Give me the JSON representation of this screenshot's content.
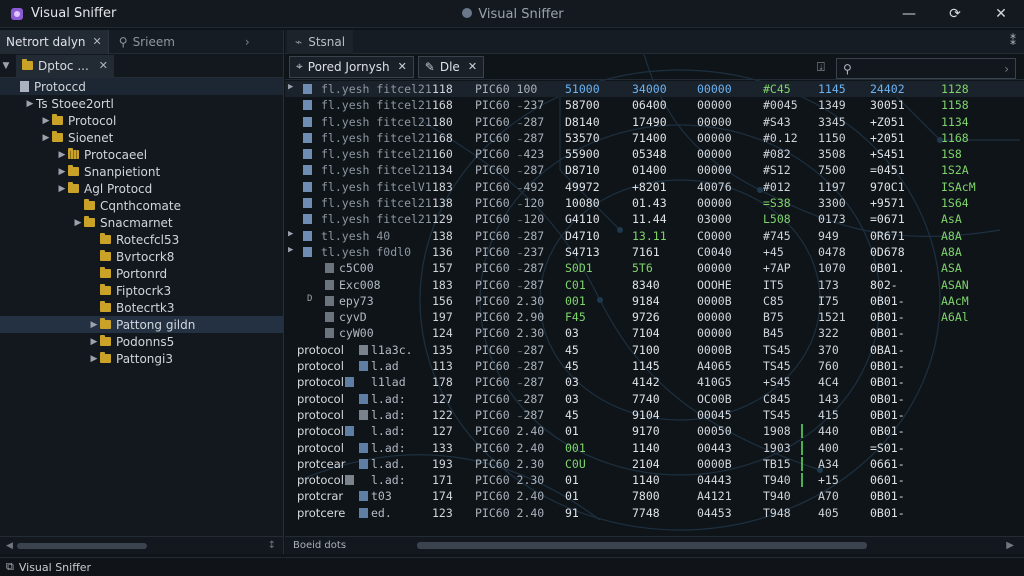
{
  "app": {
    "title": "Visual Sniffer",
    "center_title": "Visual Sniffer"
  },
  "colors": {
    "background": "#0f1419",
    "accent_blue": "#6db3f2",
    "accent_green": "#5cb85c",
    "folder": "#c9a227"
  },
  "left": {
    "tab_label": "Netrort dalyn",
    "search_label": "Srieem",
    "subtab_label": "Dptoc ...",
    "tree": [
      {
        "label": "Protoccd",
        "indent": 0,
        "exp": "",
        "icon": "file",
        "state": "selected-soft"
      },
      {
        "label": "Ts Stoee2ortl",
        "indent": 1,
        "exp": "▶",
        "icon": "none",
        "state": ""
      },
      {
        "label": "Protocol",
        "indent": 2,
        "exp": "▶",
        "icon": "folder",
        "state": ""
      },
      {
        "label": "Sioenet",
        "indent": 2,
        "exp": "▶",
        "icon": "folder",
        "state": ""
      },
      {
        "label": "Protocaeel",
        "indent": 3,
        "exp": "▶",
        "icon": "grid",
        "state": ""
      },
      {
        "label": "Snanpietiont",
        "indent": 3,
        "exp": "▶",
        "icon": "folder",
        "state": ""
      },
      {
        "label": "Agl Protocd",
        "indent": 3,
        "exp": "▶",
        "icon": "folder",
        "state": ""
      },
      {
        "label": "Cqnthcomate",
        "indent": 4,
        "exp": "",
        "icon": "folder",
        "state": ""
      },
      {
        "label": "Snacmarnet",
        "indent": 4,
        "exp": "▶",
        "icon": "folder",
        "state": ""
      },
      {
        "label": "Rotecfcl53",
        "indent": 5,
        "exp": "",
        "icon": "folder",
        "state": ""
      },
      {
        "label": "Bvrtocrk8",
        "indent": 5,
        "exp": "",
        "icon": "folder",
        "state": ""
      },
      {
        "label": "Portonrd",
        "indent": 5,
        "exp": "",
        "icon": "folder",
        "state": ""
      },
      {
        "label": "Fiptocrk3",
        "indent": 5,
        "exp": "",
        "icon": "folder",
        "state": ""
      },
      {
        "label": "Botecrtk3",
        "indent": 5,
        "exp": "",
        "icon": "folder",
        "state": ""
      },
      {
        "label": "Pattong gildn",
        "indent": 5,
        "exp": "▶",
        "icon": "folder",
        "state": "selected"
      },
      {
        "label": "Podonns5",
        "indent": 5,
        "exp": "▶",
        "icon": "folder",
        "state": ""
      },
      {
        "label": "Pattongi3",
        "indent": 5,
        "exp": "▶",
        "icon": "folder",
        "state": ""
      }
    ]
  },
  "right": {
    "tab_label": "Stsnal",
    "filter_tab_1": "Pored Jornysh",
    "filter_tab_2": "Dle",
    "bottom_text": "Boeid dots",
    "rows": [
      {
        "kind": "top",
        "mark": "▶",
        "name": "fl.yesh  fitcel21",
        "a": "118",
        "b": "PIC60 100",
        "c": "51000",
        "d": "34000",
        "e": "00000",
        "f": "#C45",
        "g": "1145",
        "h": "24402",
        "i": "1128",
        "cc": "blue",
        "dc": "blue",
        "ec": "blue",
        "fc": "green",
        "gc": "blue",
        "hc": "blue",
        "ic": "green"
      },
      {
        "kind": "top",
        "mark": "",
        "name": "fl.yesh  fitcel21",
        "a": "168",
        "b": "PIC60 ₋237",
        "c": "58700",
        "d": "06400",
        "e": "00000",
        "f": "#0045",
        "g": "1349",
        "h": "30051",
        "i": "1158",
        "ic": "green"
      },
      {
        "kind": "top",
        "mark": "",
        "name": "fl.yesh  fitcel21",
        "a": "180",
        "b": "PIC60 ₋287",
        "c": "D8140",
        "d": "17490",
        "e": "00000",
        "f": "#S43",
        "g": "3345",
        "h": "+Z051",
        "i": "1134",
        "ic": "green"
      },
      {
        "kind": "top",
        "mark": "",
        "name": "fl.yesh  fitcel21",
        "a": "168",
        "b": "PIC60 ₋287",
        "c": "53570",
        "d": "71400",
        "e": "00000",
        "f": "#0.12",
        "g": "1150",
        "h": "+2051",
        "i": "1168",
        "ic": "green"
      },
      {
        "kind": "top",
        "mark": "",
        "name": "fl.yesh  fitcel21",
        "a": "160",
        "b": "PIC60 ₋423",
        "c": "55900",
        "d": "05348",
        "e": "00000",
        "f": "#082",
        "g": "3508",
        "h": "+S451",
        "i": "1S8",
        "ic": "green"
      },
      {
        "kind": "top",
        "mark": "",
        "name": "fl.yesh  fitcel21",
        "a": "134",
        "b": "PIC60 ₋287",
        "c": "D8710",
        "d": "01400",
        "e": "00000",
        "f": "#S12",
        "g": "7500",
        "h": "=0451",
        "i": "1S2A",
        "ic": "green"
      },
      {
        "kind": "top",
        "mark": "",
        "name": "fl.yesh  fitcelV1",
        "a": "183",
        "b": "PIC60 ₋492",
        "c": "49972",
        "d": "+8201",
        "e": "40076",
        "f": "#012",
        "g": "1197",
        "h": "970C1",
        "i": "ISAcM",
        "ic": "green"
      },
      {
        "kind": "top",
        "mark": "",
        "name": "fl.yesh  fitcel21",
        "a": "138",
        "b": "PIC60 ₋120",
        "c": "10080",
        "d": "01.43",
        "e": "00000",
        "f": "=S38",
        "g": "3300",
        "h": "+9571",
        "i": "1S64",
        "fc": "green",
        "ic": "green"
      },
      {
        "kind": "top",
        "mark": "",
        "name": "fl.yesh  fitcel21",
        "a": "129",
        "b": "PIC60 ₋120",
        "c": "G4110",
        "d": "11.44",
        "e": "03000",
        "f": "L508",
        "g": "0173",
        "h": "=0671",
        "i": "AsA",
        "fc": "green",
        "ic": "green"
      },
      {
        "kind": "top",
        "mark": "▶",
        "name": "tl.yesh  40",
        "a": "138",
        "b": "PIC60 ₋287",
        "c": "D4710",
        "d": "13.11",
        "e": "C0000",
        "f": "#745",
        "g": "949",
        "h": "0R671",
        "i": "A8A",
        "dc": "green",
        "ic": "green"
      },
      {
        "kind": "top",
        "mark": "▶",
        "name": "tl.yesh  f0dl0",
        "a": "136",
        "b": "PIC60 ₋237",
        "c": "S4713",
        "d": "7161",
        "e": "C0040",
        "f": "+45",
        "g": "0478",
        "h": "0D678",
        "i": "A8A",
        "ic": "green"
      },
      {
        "kind": "sub",
        "mark": "",
        "name": "c5C00",
        "a": "157",
        "b": "PIC60 ₋287",
        "c": "S0D1",
        "d": "5T6",
        "e": "00000",
        "f": "+7AP",
        "g": "1070",
        "h": "0B01.",
        "i": "ASA",
        "cc": "green",
        "dc": "green",
        "ic": "green"
      },
      {
        "kind": "sub",
        "mark": "",
        "name": "Exc008",
        "a": "183",
        "b": "PIC60 ₋287",
        "c": "C01",
        "d": "8340",
        "e": "OOOHE",
        "f": "IT5",
        "g": "173",
        "h": "802-",
        "i": "ASAN",
        "cc": "green",
        "ic": "green"
      },
      {
        "kind": "sub2",
        "mark": "D",
        "name": "epy73",
        "a": "156",
        "b": "PIC60 2.30",
        "c": "001",
        "d": "9184",
        "e": "0000B",
        "f": "C85",
        "g": "I75",
        "h": "0B01-",
        "i": "AAcM",
        "cc": "green",
        "ic": "green"
      },
      {
        "kind": "sub",
        "mark": "",
        "name": "cyvD",
        "a": "197",
        "b": "PIC60 2.90",
        "c": "F45",
        "d": "9726",
        "e": "00000",
        "f": "B75",
        "g": "1521",
        "h": "0B01-",
        "i": "A6Al",
        "cc": "green",
        "ic": "green"
      },
      {
        "kind": "sub",
        "mark": "",
        "name": "cyW00",
        "a": "124",
        "b": "PIC60 2.30",
        "c": "03",
        "d": "7104",
        "e": "00000",
        "f": "B45",
        "g": "322",
        "h": "0B01-",
        "i": ""
      },
      {
        "kind": "proto",
        "label": "protocol",
        "name": "l1a3c.",
        "a": "135",
        "b": "PIC60 ₋287",
        "c": "45",
        "d": "7100",
        "e": "0000B",
        "f": "TS45",
        "g": "370",
        "h": "0BA1-",
        "i": ""
      },
      {
        "kind": "proto",
        "label": "protocol",
        "name": "l.ad",
        "a": "113",
        "b": "PIC60 ₋287",
        "c": "45",
        "d": "1145",
        "e": "A4065",
        "f": "TS45",
        "g": "760",
        "h": "0B01-",
        "i": ""
      },
      {
        "kind": "proto",
        "label": "protocol",
        "name": "l1lad",
        "a": "178",
        "b": "PIC60 ₋287",
        "c": "03",
        "d": "4142",
        "e": "410G5",
        "f": "+S45",
        "g": "4C4",
        "h": "0B01-",
        "i": ""
      },
      {
        "kind": "proto",
        "label": "protocol",
        "name": "l.ad:",
        "a": "127",
        "b": "PIC60 ₋287",
        "c": "03",
        "d": "7740",
        "e": "OC00B",
        "f": "C845",
        "g": "143",
        "h": "0B01-",
        "i": ""
      },
      {
        "kind": "proto",
        "label": "protocol",
        "name": "l.ad:",
        "a": "122",
        "b": "PIC60 ₋287",
        "c": "45",
        "d": "9104",
        "e": "00045",
        "f": "TS45",
        "g": "415",
        "h": "0B01-",
        "i": ""
      },
      {
        "kind": "proto",
        "label": "protocol",
        "name": "l.ad:",
        "a": "127",
        "b": "PIC60 2.40",
        "c": "01",
        "d": "9170",
        "e": "00050",
        "f": "1908",
        "g": "440",
        "h": "0B01-",
        "i": "",
        "bar": true
      },
      {
        "kind": "proto",
        "label": "protocol",
        "name": "l.ad:",
        "a": "133",
        "b": "PIC60 2.40",
        "c": "001",
        "d": "1140",
        "e": "00443",
        "f": "1903",
        "g": "400",
        "h": "=S01-",
        "i": "",
        "cc": "green",
        "bar": true
      },
      {
        "kind": "proto",
        "label": "protcear",
        "name": "l.ad.",
        "a": "193",
        "b": "PIC60 2.30",
        "c": "C0U",
        "d": "2104",
        "e": "0000B",
        "f": "TB15",
        "g": "A34",
        "h": "0661-",
        "i": "",
        "cc": "green",
        "bar": true
      },
      {
        "kind": "proto",
        "label": "protocol",
        "name": "l.ad:",
        "a": "171",
        "b": "PIC60 2.30",
        "c": "01",
        "d": "1140",
        "e": "04443",
        "f": "T940",
        "g": "+15",
        "h": "0601-",
        "i": "",
        "bar": true
      },
      {
        "kind": "proto",
        "label": "protcrar",
        "name": "t03",
        "a": "174",
        "b": "PIC60 2.40",
        "c": "01",
        "d": "7800",
        "e": "A4121",
        "f": "T940",
        "g": "A70",
        "h": "0B01-",
        "i": ""
      },
      {
        "kind": "proto",
        "label": "protcere",
        "name": "ed.",
        "a": "123",
        "b": "PIC60 2.40",
        "c": "91",
        "d": "7748",
        "e": "04453",
        "f": "T948",
        "g": "405",
        "h": "0B01-",
        "i": ""
      }
    ]
  },
  "status": {
    "text": "Visual Sniffer"
  }
}
